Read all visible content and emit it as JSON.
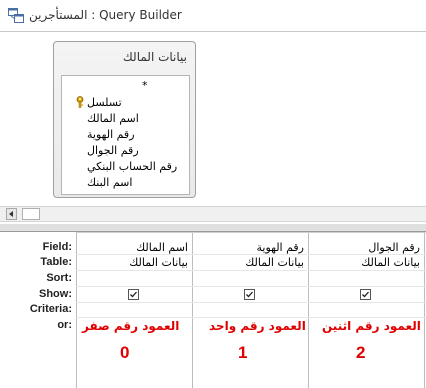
{
  "window": {
    "title_prefix": "المستأجرين",
    "title_sep": " : ",
    "title_suffix": "Query Builder"
  },
  "table": {
    "title": "بيانات المالك",
    "fields": [
      "*",
      "تسلسل",
      "اسم المالك",
      "رقم الهوية",
      "رقم الجوال",
      "رقم الحساب البنكي",
      "اسم البنك"
    ],
    "primary_key_field_index": 1
  },
  "grid": {
    "row_labels": [
      "Field:",
      "Table:",
      "Sort:",
      "Show:",
      "Criteria:",
      "or:"
    ],
    "columns": [
      {
        "field": "اسم المالك",
        "table": "بيانات المالك",
        "show": true,
        "note": "العمود رقم صفر",
        "number": "0"
      },
      {
        "field": "رقم الهوية",
        "table": "بيانات المالك",
        "show": true,
        "note": "العمود رقم واحد",
        "number": "1"
      },
      {
        "field": "رقم الجوال",
        "table": "بيانات المالك",
        "show": true,
        "note": "العمود رقم اثنين",
        "number": "2"
      }
    ]
  },
  "colors": {
    "annotation": "#e00000",
    "checkbox_border": "#555555"
  }
}
